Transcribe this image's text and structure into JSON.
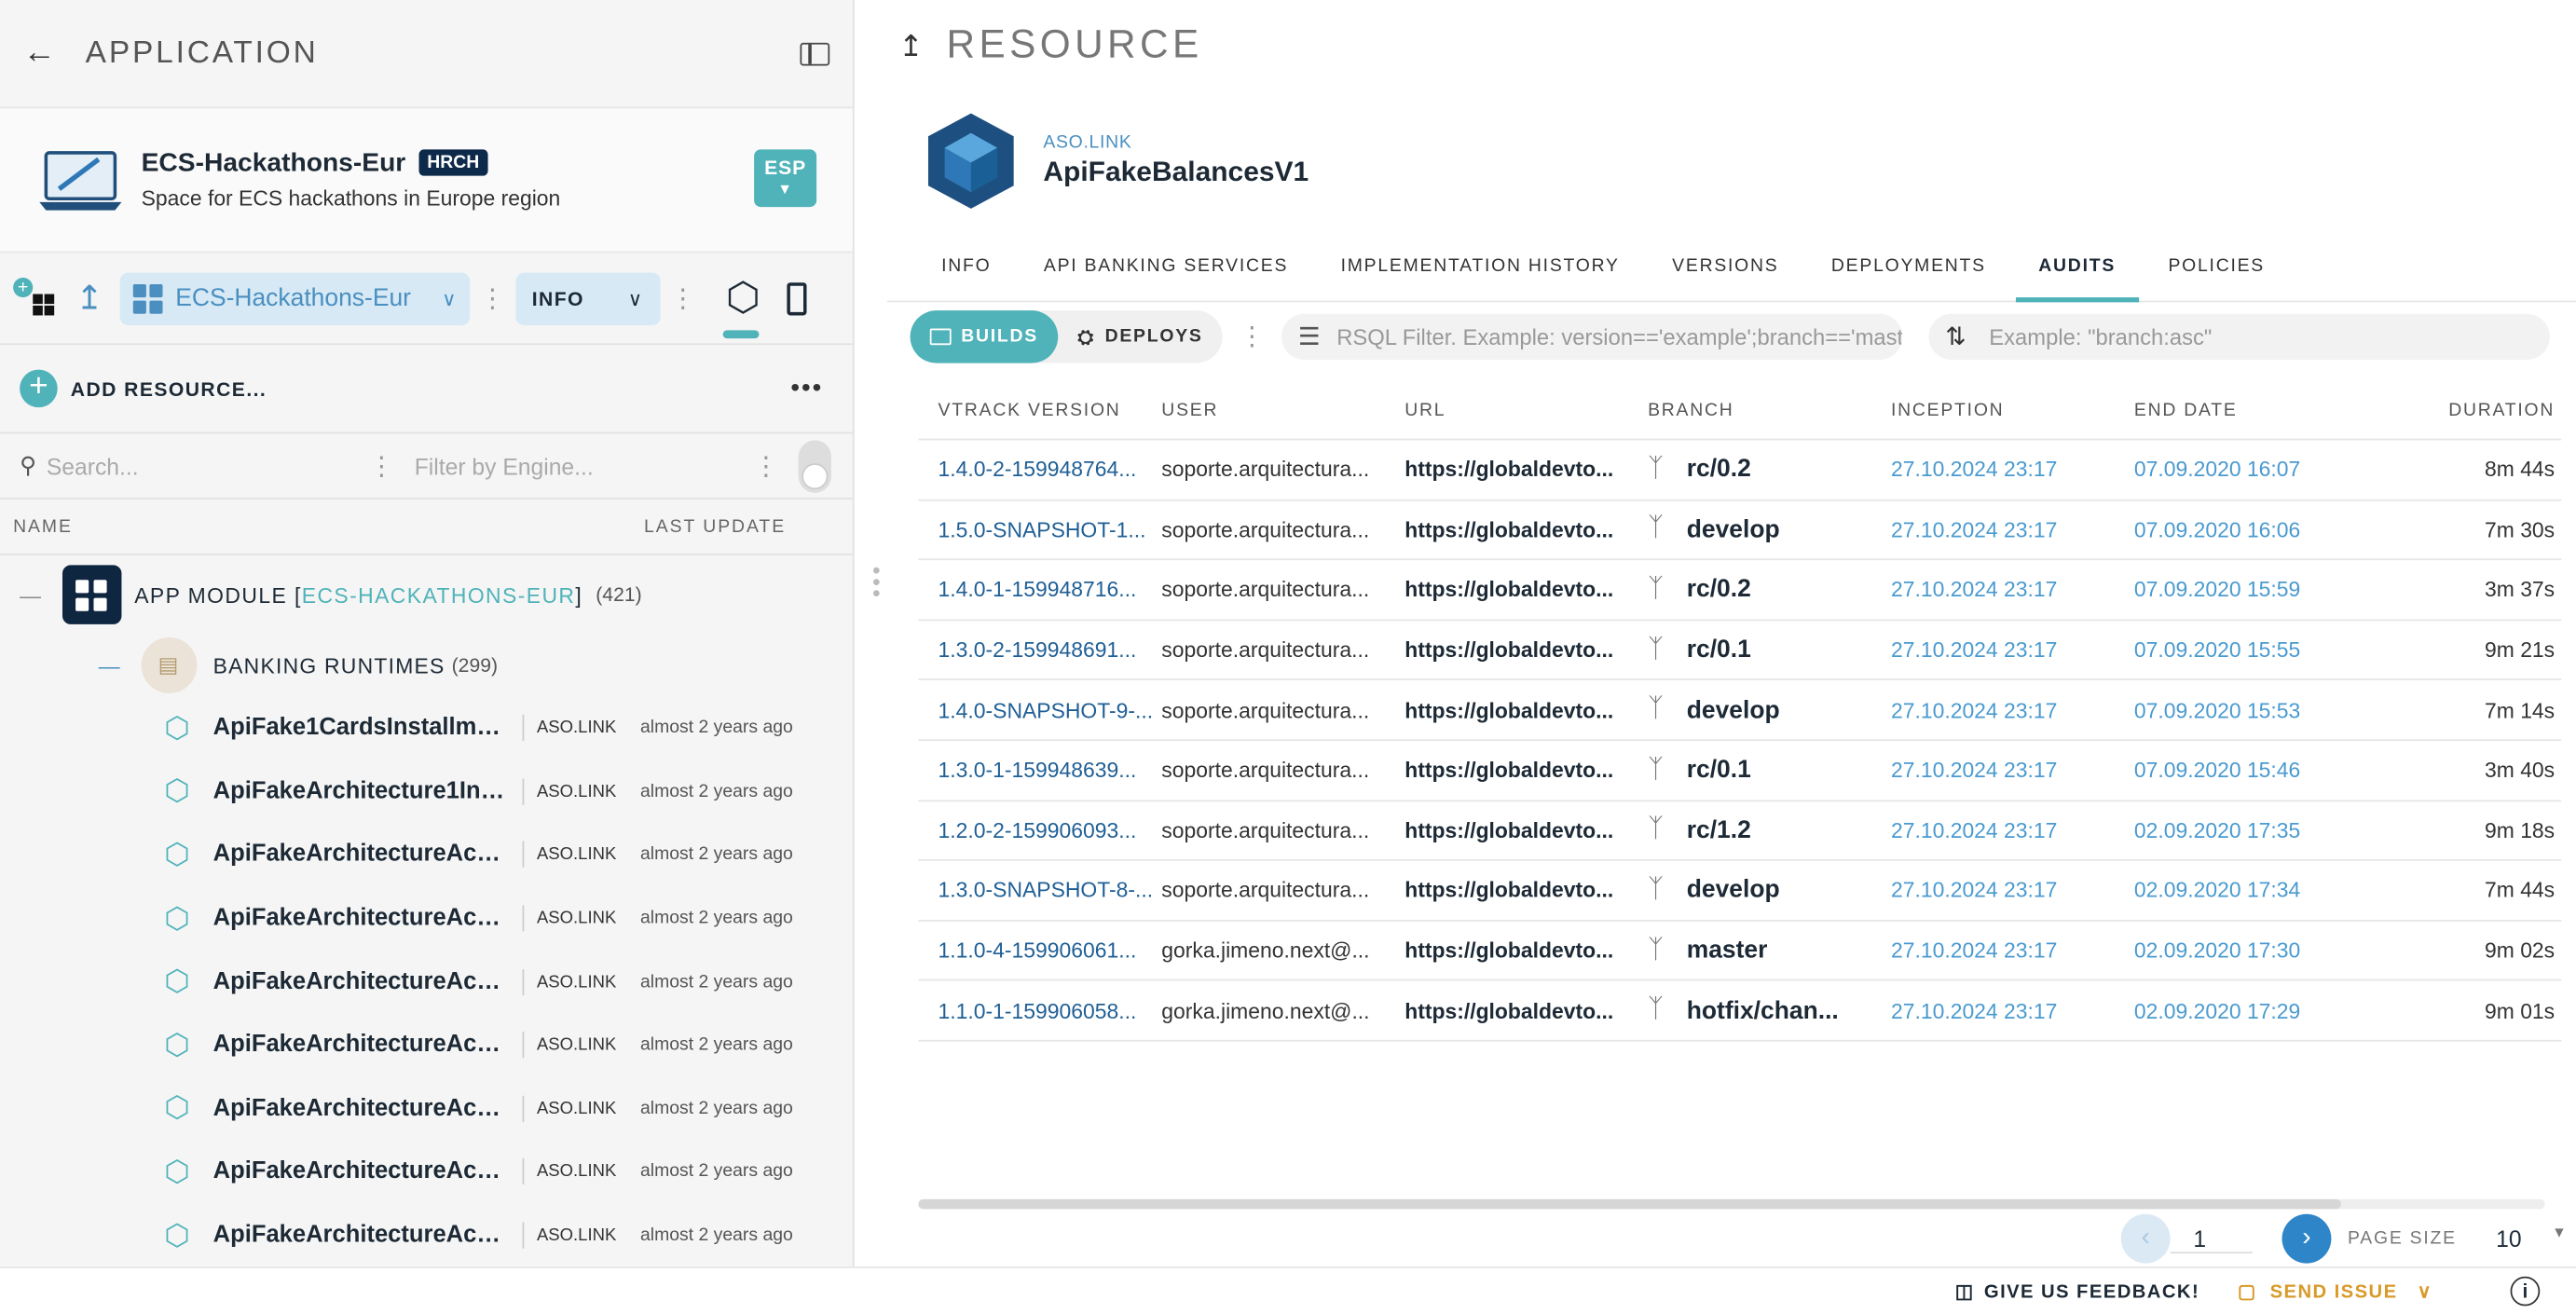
{
  "left": {
    "header_title": "APPLICATION",
    "app": {
      "name": "ECS-Hackathons-Eur",
      "badge": "HRCH",
      "description": "Space for ECS hackathons in Europe region",
      "region_button": "ESP"
    },
    "toolbar": {
      "app_selector": "ECS-Hackathons-Eur",
      "view_selector": "INFO"
    },
    "add_resource": "ADD RESOURCE...",
    "search_placeholder": "Search...",
    "engine_filter_placeholder": "Filter by Engine...",
    "columns": {
      "name": "NAME",
      "last_update": "LAST UPDATE"
    },
    "module": {
      "prefix": "APP MODULE [",
      "name": "ECS-HACKATHONS-EUR",
      "suffix": "]",
      "count": "(421)"
    },
    "runtimes": {
      "label": "BANKING RUNTIMES",
      "count": "(299)"
    },
    "items": [
      {
        "name": "ApiFake1CardsInstallme...",
        "type": "ASO.LINK",
        "updated": "almost 2 years ago"
      },
      {
        "name": "ApiFakeArchitecture1Inc...",
        "type": "ASO.LINK",
        "updated": "almost 2 years ago"
      },
      {
        "name": "ApiFakeArchitectureAcc...",
        "type": "ASO.LINK",
        "updated": "almost 2 years ago"
      },
      {
        "name": "ApiFakeArchitectureAcc...",
        "type": "ASO.LINK",
        "updated": "almost 2 years ago"
      },
      {
        "name": "ApiFakeArchitectureAcc...",
        "type": "ASO.LINK",
        "updated": "almost 2 years ago"
      },
      {
        "name": "ApiFakeArchitectureAcc...",
        "type": "ASO.LINK",
        "updated": "almost 2 years ago"
      },
      {
        "name": "ApiFakeArchitectureAcc...",
        "type": "ASO.LINK",
        "updated": "almost 2 years ago"
      },
      {
        "name": "ApiFakeArchitectureAcc...",
        "type": "ASO.LINK",
        "updated": "almost 2 years ago"
      },
      {
        "name": "ApiFakeArchitectureAcc...",
        "type": "ASO.LINK",
        "updated": "almost 2 years ago"
      }
    ]
  },
  "right": {
    "header_title": "RESOURCE",
    "resource": {
      "type": "ASO.LINK",
      "name": "ApiFakeBalancesV1"
    },
    "tabs": [
      "INFO",
      "API BANKING SERVICES",
      "IMPLEMENTATION HISTORY",
      "VERSIONS",
      "DEPLOYMENTS",
      "AUDITS",
      "POLICIES"
    ],
    "active_tab": "AUDITS",
    "toggle": {
      "builds": "BUILDS",
      "deploys": "DEPLOYS"
    },
    "rsql_placeholder": "RSQL Filter. Example: version=='example';branch=='master'",
    "sort_placeholder": "Example: \"branch:asc\"",
    "columns": [
      "VTRACK VERSION",
      "USER",
      "URL",
      "BRANCH",
      "INCEPTION",
      "END DATE",
      "DURATION"
    ],
    "rows": [
      {
        "version": "1.4.0-2-159948764...",
        "user": "soporte.arquitectura...",
        "url": "https://globaldevto...",
        "branch": "rc/0.2",
        "inception": "27.10.2024 23:17",
        "end": "07.09.2020 16:07",
        "duration": "8m 44s"
      },
      {
        "version": "1.5.0-SNAPSHOT-1...",
        "user": "soporte.arquitectura...",
        "url": "https://globaldevto...",
        "branch": "develop",
        "inception": "27.10.2024 23:17",
        "end": "07.09.2020 16:06",
        "duration": "7m 30s"
      },
      {
        "version": "1.4.0-1-159948716...",
        "user": "soporte.arquitectura...",
        "url": "https://globaldevto...",
        "branch": "rc/0.2",
        "inception": "27.10.2024 23:17",
        "end": "07.09.2020 15:59",
        "duration": "3m 37s"
      },
      {
        "version": "1.3.0-2-159948691...",
        "user": "soporte.arquitectura...",
        "url": "https://globaldevto...",
        "branch": "rc/0.1",
        "inception": "27.10.2024 23:17",
        "end": "07.09.2020 15:55",
        "duration": "9m 21s"
      },
      {
        "version": "1.4.0-SNAPSHOT-9-...",
        "user": "soporte.arquitectura...",
        "url": "https://globaldevto...",
        "branch": "develop",
        "inception": "27.10.2024 23:17",
        "end": "07.09.2020 15:53",
        "duration": "7m 14s"
      },
      {
        "version": "1.3.0-1-159948639...",
        "user": "soporte.arquitectura...",
        "url": "https://globaldevto...",
        "branch": "rc/0.1",
        "inception": "27.10.2024 23:17",
        "end": "07.09.2020 15:46",
        "duration": "3m 40s"
      },
      {
        "version": "1.2.0-2-159906093...",
        "user": "soporte.arquitectura...",
        "url": "https://globaldevto...",
        "branch": "rc/1.2",
        "inception": "27.10.2024 23:17",
        "end": "02.09.2020 17:35",
        "duration": "9m 18s"
      },
      {
        "version": "1.3.0-SNAPSHOT-8-...",
        "user": "soporte.arquitectura...",
        "url": "https://globaldevto...",
        "branch": "develop",
        "inception": "27.10.2024 23:17",
        "end": "02.09.2020 17:34",
        "duration": "7m 44s"
      },
      {
        "version": "1.1.0-4-159906061...",
        "user": "gorka.jimeno.next@...",
        "url": "https://globaldevto...",
        "branch": "master",
        "inception": "27.10.2024 23:17",
        "end": "02.09.2020 17:30",
        "duration": "9m 02s"
      },
      {
        "version": "1.1.0-1-159906058...",
        "user": "gorka.jimeno.next@...",
        "url": "https://globaldevto...",
        "branch": "hotfix/chan...",
        "inception": "27.10.2024 23:17",
        "end": "02.09.2020 17:29",
        "duration": "9m 01s"
      }
    ],
    "pagination": {
      "page": "1",
      "page_size_label": "PAGE SIZE",
      "page_size": "10"
    }
  },
  "footer": {
    "feedback": "GIVE US FEEDBACK!",
    "send_issue": "SEND ISSUE"
  },
  "colors": {
    "accent": "#4fb3b9",
    "navy": "#0f2640",
    "link": "#4a9ad0"
  }
}
